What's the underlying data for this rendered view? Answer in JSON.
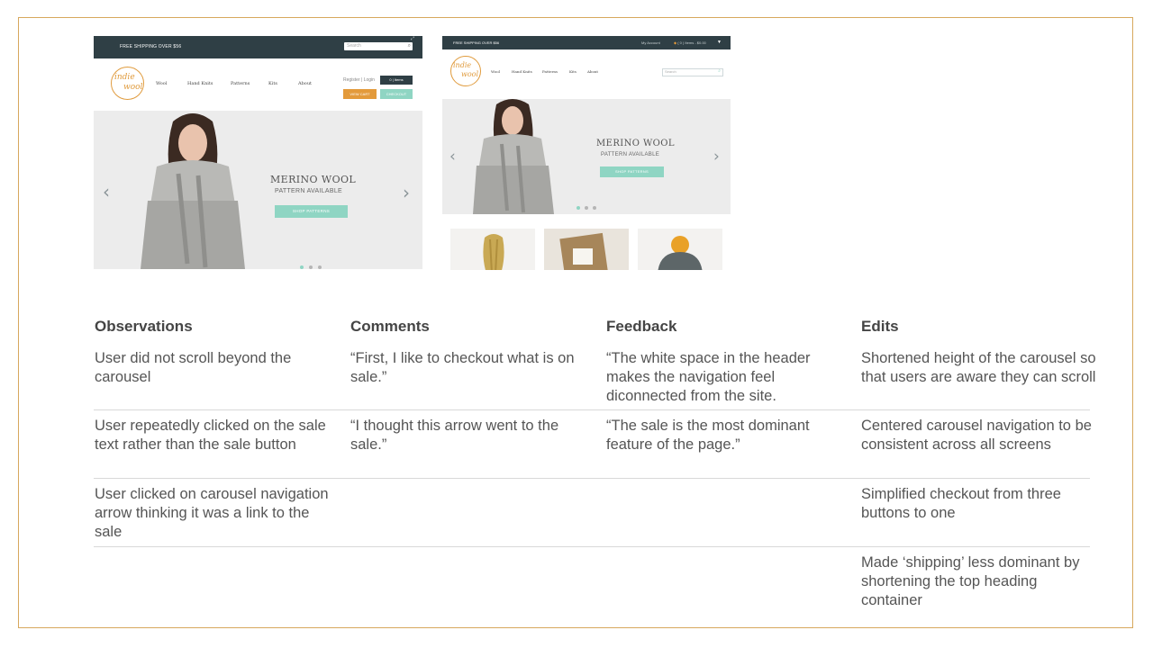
{
  "screenshot_v1": {
    "shipping_banner": "FREE SHIPPING OVER $56",
    "search_placeholder": "Search",
    "logo_line1": "indie",
    "logo_line2": "wool",
    "nav": [
      "Wool",
      "Hand Knits",
      "Patterns",
      "Kits",
      "About"
    ],
    "register_login": "Register | Login",
    "cart_label": "0 | Items",
    "view_cart": "VIEW CART",
    "checkout": "CHECKOUT",
    "hero_title": "MERINO WOOL",
    "hero_subtitle": "PATTERN AVAILABLE",
    "hero_button": "SHOP PATTERNS"
  },
  "screenshot_v2": {
    "shipping_banner": "FREE SHIPPING OVER $56",
    "my_account": "My Account",
    "cart_label": "( 0 ) Items - $0.00",
    "logo_line1": "indie",
    "logo_line2": "wool",
    "nav": [
      "Wool",
      "Hand Knits",
      "Patterns",
      "Kits",
      "About"
    ],
    "search_placeholder": "Search",
    "hero_title": "MERINO WOOL",
    "hero_subtitle": "PATTERN AVAILABLE",
    "hero_button": "SHOP PATTERNS"
  },
  "table": {
    "headers": [
      "Observations",
      "Comments",
      "Feedback",
      "Edits"
    ],
    "rows": [
      {
        "observation": "User did not scroll beyond the carousel",
        "comment": "“First, I like to checkout what is on sale.”",
        "feedback": "“The white space in the header makes the navigation feel diconnected from the site.",
        "edit": "Shortened height of the carousel so that users are aware they can scroll"
      },
      {
        "observation": "User repeatedly clicked on the sale text rather than the sale button",
        "comment": "“I thought this arrow went to the sale.”",
        "feedback": "“The sale is the most dominant feature of the page.”",
        "edit": "Centered carousel navigation to be consistent across all screens"
      },
      {
        "observation": "User clicked on carousel navigation arrow thinking it was a link to the sale",
        "comment": "",
        "feedback": "",
        "edit": "Simplified checkout from three buttons to one"
      },
      {
        "observation": "",
        "comment": "",
        "feedback": "",
        "edit": "Made ‘shipping’ less dominant by shortening the top heading container"
      }
    ]
  },
  "colors": {
    "frame_border": "#d7a85d",
    "topbar": "#2f3f45",
    "accent_orange": "#e39a3b",
    "accent_mint": "#8fd5c3",
    "hero_bg": "#ececec"
  }
}
